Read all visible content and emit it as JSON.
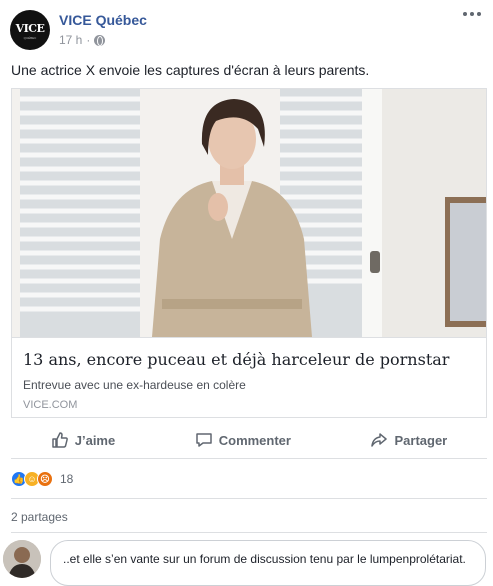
{
  "post": {
    "page_name": "VICE Québec",
    "time": "17 h",
    "separator": "·",
    "avatar_logo": "VICE",
    "avatar_sub": "QUÉBEC",
    "text": "Une actrice X envoie les captures d'écran à leurs parents."
  },
  "link_card": {
    "title": "13 ans, encore puceau et déjà harceleur de pornstar",
    "description": "Entrevue avec une ex-hardeuse en colère",
    "domain": "VICE.COM"
  },
  "actions": {
    "like": "J’aime",
    "comment": "Commenter",
    "share": "Partager"
  },
  "reactions": {
    "types": [
      "like",
      "haha",
      "angry"
    ],
    "count": "18"
  },
  "shares": "2 partages",
  "comment_box": {
    "value": "..et elle s’en vante sur un forum de discussion tenu par le lumpenprolétariat."
  },
  "colors": {
    "link": "#365899",
    "meta": "#90949c",
    "like": "#2078f4",
    "haha": "#f7b125",
    "angry": "#e9710f"
  },
  "icons": [
    "globe-icon",
    "more-options-icon",
    "thumbs-up-icon",
    "comment-icon",
    "share-icon"
  ]
}
